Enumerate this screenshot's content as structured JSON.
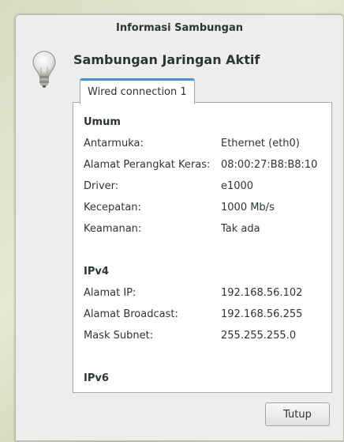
{
  "window": {
    "title": "Informasi Sambungan"
  },
  "heading": "Sambungan Jaringan Aktif",
  "icons": {
    "bulb": "lightbulb-icon"
  },
  "tabs": [
    {
      "label": "Wired connection 1"
    }
  ],
  "general": {
    "title": "Umum",
    "rows": [
      {
        "label": "Antarmuka:",
        "value": "Ethernet (eth0)"
      },
      {
        "label": "Alamat Perangkat Keras:",
        "value": "08:00:27:B8:B8:10"
      },
      {
        "label": "Driver:",
        "value": "e1000"
      },
      {
        "label": "Kecepatan:",
        "value": "1000 Mb/s"
      },
      {
        "label": "Keamanan:",
        "value": "Tak ada"
      }
    ]
  },
  "ipv4": {
    "title": "IPv4",
    "rows": [
      {
        "label": "Alamat IP:",
        "value": "192.168.56.102"
      },
      {
        "label": "Alamat Broadcast:",
        "value": "192.168.56.255"
      },
      {
        "label": "Mask Subnet:",
        "value": "255.255.255.0"
      }
    ]
  },
  "ipv6": {
    "title": "IPv6"
  },
  "buttons": {
    "close": "Tutup"
  },
  "colors": {
    "tab_accent": "#4a90d9",
    "text": "#2e3436",
    "dialog_bg": "#ededeb"
  }
}
